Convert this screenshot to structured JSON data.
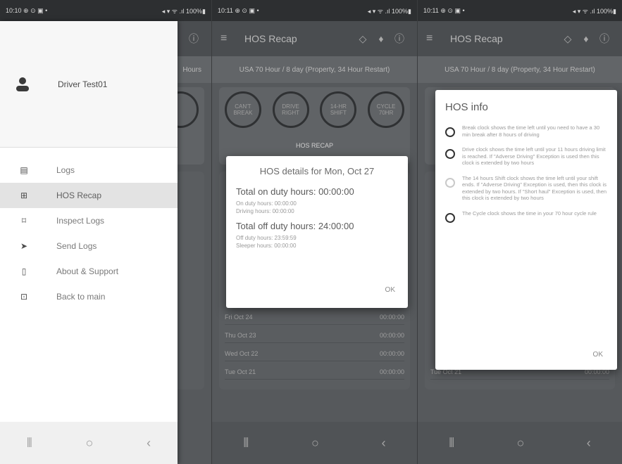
{
  "left": {
    "status_time": "10:10 ⊕ ⊙ ▣ •",
    "status_right": "◂ ▾ ᯤ .ıl 100%▮",
    "hos_type": "Hours",
    "drawer": {
      "driver_name": "Driver Test01",
      "items": [
        {
          "label": "Logs"
        },
        {
          "label": "HOS Recap"
        },
        {
          "label": "Inspect Logs"
        },
        {
          "label": "Send Logs"
        },
        {
          "label": "About & Support"
        },
        {
          "label": "Back to main"
        }
      ]
    },
    "nav": [
      "⦀",
      "○",
      "‹"
    ]
  },
  "middle": {
    "status_time": "10:11 ⊕ ⊙ ▣ •",
    "status_right": "◂ ▾ ᯤ .ıl 100%▮",
    "title": "HOS Recap",
    "hos_type": "USA 70 Hour / 8 day (Property, 34 Hour Restart)",
    "circles": [
      "CAN'T BREAK",
      "DRIVE RIGHT",
      "14-HR SHIFT",
      "CYCLE 70HR"
    ],
    "recap_title": "HOS RECAP",
    "rows": [
      {
        "date": "Fri Oct 24",
        "value": "00:00:00"
      },
      {
        "date": "Thu Oct 23",
        "value": "00:00:00"
      },
      {
        "date": "Wed Oct 22",
        "value": "00:00:00"
      },
      {
        "date": "Tue Oct 21",
        "value": "00:00:00"
      }
    ],
    "dialog": {
      "title": "HOS details for Mon, Oct 27",
      "on_duty_total": "Total on duty hours: 00:00:00",
      "on_duty_hours": "On duty hours: 00:00:00",
      "driving_hours": "Driving hours: 00:00:00",
      "off_duty_total": "Total off duty hours: 24:00:00",
      "off_duty_hours": "Off duty hours: 23:59:59",
      "sleeper_hours": "Sleeper hours: 00:00:00",
      "ok": "OK"
    },
    "nav": [
      "⦀",
      "○",
      "‹"
    ]
  },
  "right": {
    "status_time": "10:11 ⊕ ⊙ ▣ •",
    "status_right": "◂ ▾ ᯤ .ıl 100%▮",
    "title": "HOS Recap",
    "hos_type": "USA 70 Hour / 8 day (Property, 34 Hour Restart)",
    "row_date": "Tue Oct 21",
    "row_value": "00:00:00",
    "dialog": {
      "title": "HOS info",
      "options": [
        {
          "text": "Break clock shows the time left until you need to have a 30 min break after 8 hours of driving"
        },
        {
          "text": "Drive clock shows the time left until your 11 hours driving limit is reached. If \"Adverse Driving\" Exception is used then this clock is extended by two hours"
        },
        {
          "text": "The 14 hours Shift clock shows the time left until your shift ends. If \"Adverse Driving\" Exception is used, then this clock is extended by two hours. If \"Short haul\" Exception is used, then this clock is extended by two hours"
        },
        {
          "text": "The Cycle clock shows the time in your 70 hour cycle rule"
        }
      ],
      "ok": "OK"
    },
    "nav": [
      "⦀",
      "○",
      "‹"
    ]
  }
}
